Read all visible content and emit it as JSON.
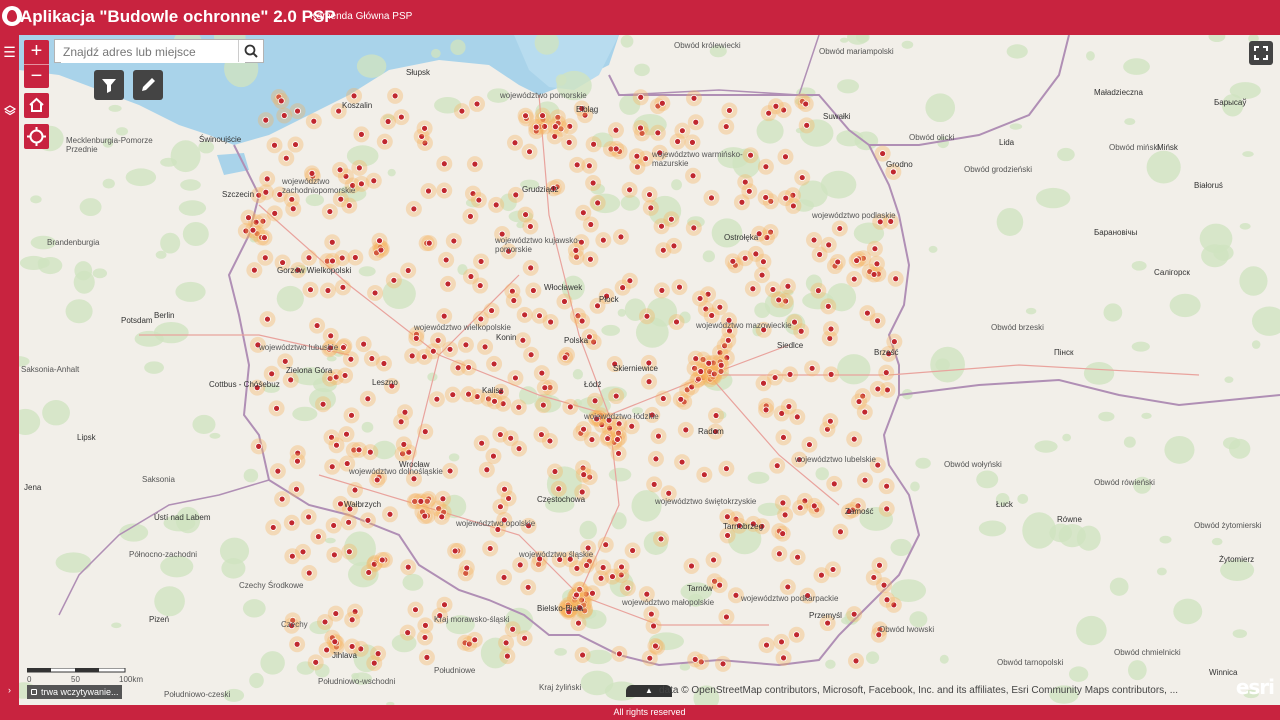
{
  "header": {
    "title": "Aplikacja \"Budowle ochronne\" 2.0 PSP",
    "subtitle": "Komenda Główna PSP"
  },
  "search": {
    "placeholder": "Znajdź adres lub miejsce"
  },
  "map": {
    "loading_text": "trwa wczytywanie...",
    "attribution": "data © OpenStreetMap contributors, Microsoft, Facebook, Inc. and its affiliates, Esri Community Maps contributors, ...",
    "scale_labels": [
      "0",
      "50",
      "100km"
    ],
    "esri_logo": "esri",
    "labels": {
      "l01": "Obwód królewiecki",
      "l02": "Obwód mariampolski",
      "l03": "Obwód olicki",
      "l04": "Maładzieczna",
      "l05": "Барысаў",
      "l06": "Lida",
      "l07": "Obwód miński",
      "l08": "Mińsk",
      "l09": "Obwód grodzieński",
      "l10": "Białoruś",
      "l11": "Grodno",
      "l12": "Барановічы",
      "l13": "Салігорск",
      "l14": "Obwód brzeski",
      "l15": "Пінск",
      "l16": "Brześć",
      "l17": "Obwód wołyński",
      "l18": "Obwód rówieński",
      "l19": "Łuck",
      "l20": "Równe",
      "l21": "Obwód żytomierski",
      "l22": "Żytomierz",
      "l23": "Obwód lwowski",
      "l24": "Obwód chmielnicki",
      "l25": "Obwód tarnopolski",
      "l26": "Winnica",
      "l27": "Słupsk",
      "l28": "Koszalin",
      "l29": "Świnoujście",
      "l30": "Mecklenburgia-Pomorze Przednie",
      "l31": "Szczecin",
      "l32": "Brandenburgia",
      "l33": "Gorzów Wielkopolski",
      "l34": "Potsdam",
      "l35": "Berlin",
      "l36": "Saksonia-Anhalt",
      "l37": "Cottbus - Chóśebuz",
      "l38": "Lipsk",
      "l39": "Saksonia",
      "l40": "Jena",
      "l41": "Ústí nad Labem",
      "l42": "Północno-zachodni",
      "l43": "Czechy Środkowe",
      "l44": "Pizeń",
      "l45": "Czechy",
      "l46": "Jihlava",
      "l47": "Południowo-czeski",
      "l48": "Południowo-wschodni",
      "l49": "Kraj morawsko-śląski",
      "l50": "Południowe",
      "l51": "Kraj żyliński",
      "l52": "Elbląg",
      "l53": "Suwałki",
      "l54": "województwo pomorskie",
      "l55": "województwo warmińsko-mazurskie",
      "l56": "województwo zachodniopomorskie",
      "l57": "Grudziądz",
      "l58": "województwo podlaskie",
      "l59": "województwo kujawsko-pomorskie",
      "l60": "Ostrołęka",
      "l61": "Włocławek",
      "l62": "Płock",
      "l63": "województwo lubuskie",
      "l64": "województwo wielkopolskie",
      "l65": "Konin",
      "l66": "Polska",
      "l67": "województwo mazowieckie",
      "l68": "Siedlce",
      "l69": "Zielona Góra",
      "l70": "Leszno",
      "l71": "Kalisz",
      "l72": "Skierniewice",
      "l73": "Łódź",
      "l74": "województwo łódzkie",
      "l75": "Radom",
      "l76": "Wrocław",
      "l77": "województwo dolnośląskie",
      "l78": "Wałbrzych",
      "l79": "województwo lubelskie",
      "l80": "Częstochowa",
      "l81": "województwo świętokrzyskie",
      "l82": "województwo opolskie",
      "l83": "Zamość",
      "l84": "Tarnobrzeg",
      "l85": "województwo śląskie",
      "l86": "Bielsko-Biała",
      "l87": "Tarnów",
      "l88": "województwo podkarpackie",
      "l89": "województwo małopolskie",
      "l90": "Przemyśl"
    }
  },
  "footer": {
    "text": "All rights reserved"
  },
  "colors": {
    "brand": "#c8233f",
    "sea": "#a9d3ea",
    "marker": "#c0282f",
    "halo": "#f7b25c"
  }
}
